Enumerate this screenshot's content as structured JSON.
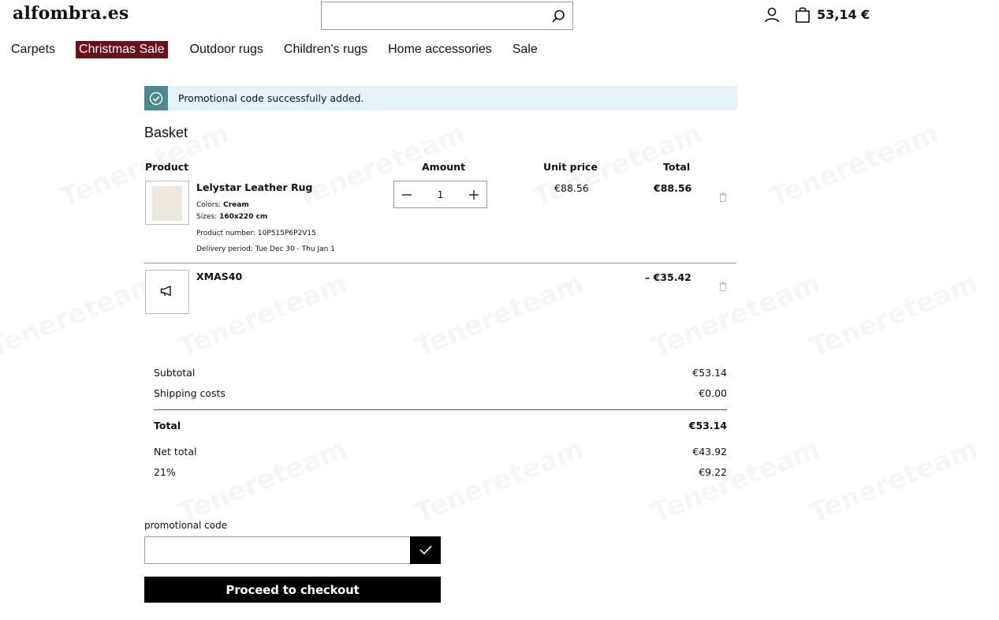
{
  "header": {
    "logo": "alfombra.es",
    "search": {
      "value": "",
      "placeholder": ""
    },
    "cart_total": "53,14 €"
  },
  "nav": {
    "items": [
      "Carpets",
      "Christmas Sale",
      "Outdoor rugs",
      "Children's rugs",
      "Home accessories",
      "Sale"
    ],
    "highlighted": "Christmas Sale",
    "highlight_color": "#6b0f1a"
  },
  "alert": {
    "text": "Promotional code successfully added.",
    "icon": "check-circle-icon",
    "accent": "#4a8a8f",
    "background": "#e3f3f7"
  },
  "basket": {
    "title": "Basket",
    "columns": {
      "product": "Product",
      "amount": "Amount",
      "unit_price": "Unit price",
      "total": "Total"
    },
    "item": {
      "name": "Lelystar Leather Rug",
      "colors_label": "Colors:",
      "colors_value": "Cream",
      "sizes_label": "Sizes:",
      "sizes_value": "160x220 cm",
      "product_number": "Product number: 10P515P6P2V15",
      "delivery": "Delivery period: Tue Dec 30 - Thu Jan 1",
      "quantity": "1",
      "unit_price": "€88.56",
      "total": "€88.56"
    },
    "promo_line": {
      "code": "XMAS40",
      "discount": "– €35.42",
      "icon": "megaphone-icon"
    }
  },
  "summary": {
    "subtotal_label": "Subtotal",
    "subtotal": "€53.14",
    "shipping_label": "Shipping costs",
    "shipping": "€0.00",
    "total_label": "Total",
    "total": "€53.14",
    "net_label": "Net total",
    "net": "€43.92",
    "vat_label": "21%",
    "vat": "€9.22"
  },
  "promo": {
    "label": "promotional code",
    "value": "",
    "placeholder": ""
  },
  "checkout_label": "Proceed to checkout",
  "watermark": "Tenereteam"
}
